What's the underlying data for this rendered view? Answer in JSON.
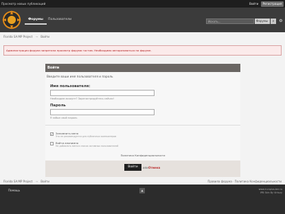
{
  "topbar": {
    "publications_label": "Просмотр новых публикаций",
    "login_label": "Войти",
    "register_label": "Регистрация"
  },
  "header": {
    "nav": {
      "forums_label": "Форумы",
      "users_label": "Пользователи"
    },
    "search": {
      "placeholder": "Искать...",
      "scope": "Форумы",
      "button_icon": "search-icon",
      "settings_icon": "gear-icon"
    }
  },
  "breadcrumbs": {
    "home": "Florida SA:MP Project",
    "separator": "→",
    "current": "Войти"
  },
  "alert": {
    "text": "Администрация форума запретила просмотр форума гостям. Необходимо авторизоваться на форуме.",
    "color": "#b11818"
  },
  "login_panel": {
    "title": "Войти",
    "subtitle": "Введите ваши имя пользователя и пароль",
    "username_label": "Имя пользователя:",
    "username_value": "",
    "username_hint": "Необходим аккаунт? Зарегистрируйтесь сейчас!",
    "password_label": "Пароль",
    "password_value": "",
    "password_hint": "Я забыл свой пароль",
    "remember_label": "Запомнить меня",
    "remember_hint": "Это не рекомендуется для публичных компьютеров",
    "remember_checked": true,
    "anon_label": "Войти анонимно",
    "anon_hint": "Не добавлять меня в список активных пользователей",
    "anon_checked": false,
    "privacy_label": "Политика Конфиденциальности",
    "submit_label": "Войти",
    "or_label": "или",
    "cancel_label": "Отмена"
  },
  "footer": {
    "links": "Правила форума · Политика Конфиденциальности",
    "help_label": "Помощь",
    "up_icon": "arrow-up-icon",
    "copyright_1": "www.ir.cnplus-bnr.ru",
    "copyright_2": "IPB Skin By Virtuzy"
  },
  "colors": {
    "accent": "#6a6663",
    "header": "#3b3b3b",
    "topbar": "#1e1e1e"
  }
}
